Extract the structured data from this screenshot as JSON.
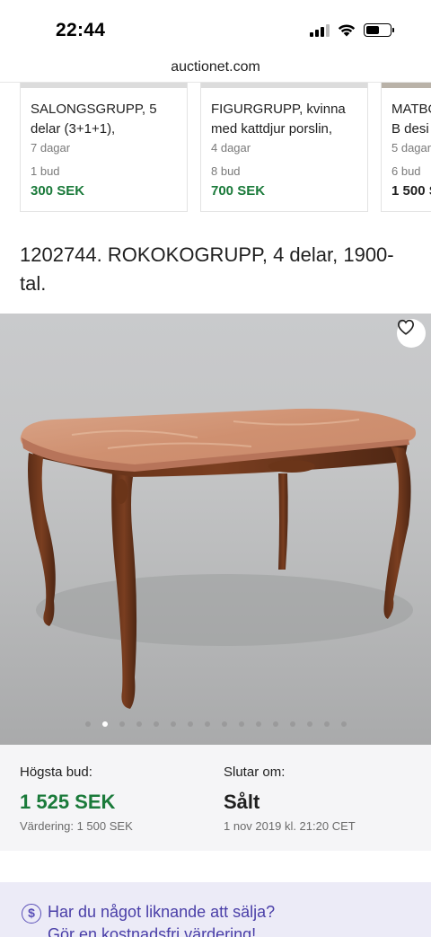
{
  "status_bar": {
    "time": "22:44",
    "icons": [
      "cellular-signal-icon",
      "wifi-icon",
      "battery-icon"
    ]
  },
  "browser": {
    "url": "auctionet.com"
  },
  "related_items": [
    {
      "title": "SALONGSGRUPP, 5 delar (3+1+1),",
      "days": "7 dagar",
      "bids": "1 bud",
      "price": "300 SEK"
    },
    {
      "title": "FIGURGRUPP, kvinna med kattdjur porslin,",
      "days": "4 dagar",
      "bids": "8 bud",
      "price": "700 SEK"
    },
    {
      "title": "MATBO B desi",
      "days": "5 dagar",
      "bids": "6 bud",
      "price": "1 500 S"
    }
  ],
  "lot": {
    "title": "1202744. ROKOKOGRUPP, 4 delar, 1900-tal.",
    "image_icon": "table-photo",
    "favorite_icon": "heart-icon",
    "image_count": 16,
    "active_image_index": 1
  },
  "bidding": {
    "highest_bid_label": "Högsta bud:",
    "highest_bid": "1 525 SEK",
    "valuation": "Värdering: 1 500 SEK",
    "ends_label": "Slutar om:",
    "status": "Sålt",
    "end_date": "1 nov 2019 kl. 21:20 CET"
  },
  "sell_banner": {
    "icon": "dollar-circle-icon",
    "line1": "Har du något liknande att sälja?",
    "line2": "Gör en kostnadsfri värdering!"
  },
  "colors": {
    "price_green": "#1a7a3a",
    "banner_bg": "#ecebf7",
    "banner_text": "#4a3fa8"
  }
}
